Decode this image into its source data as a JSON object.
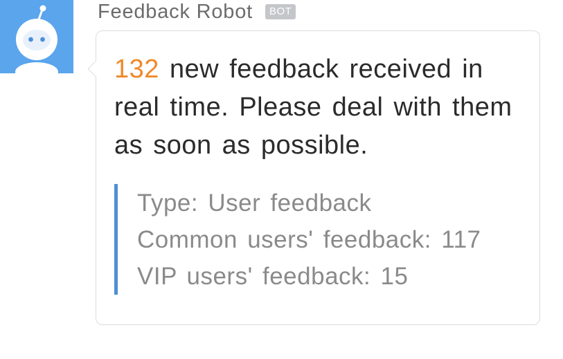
{
  "sender": {
    "name": "Feedback Robot",
    "badge": "BOT"
  },
  "message": {
    "count": "132",
    "text": " new feedback received in real time. Please deal with them as soon as possible."
  },
  "details": {
    "type_line": "Type: User feedback",
    "common_line": "Common users' feedback: 117",
    "vip_line": "VIP users' feedback: 15"
  },
  "colors": {
    "avatar_bg": "#5aa5ec",
    "count_accent": "#f0892a",
    "quote_bar": "#4d8fd6",
    "badge_bg": "#c4c6c9"
  },
  "icons": {
    "avatar": "robot-avatar-icon"
  }
}
